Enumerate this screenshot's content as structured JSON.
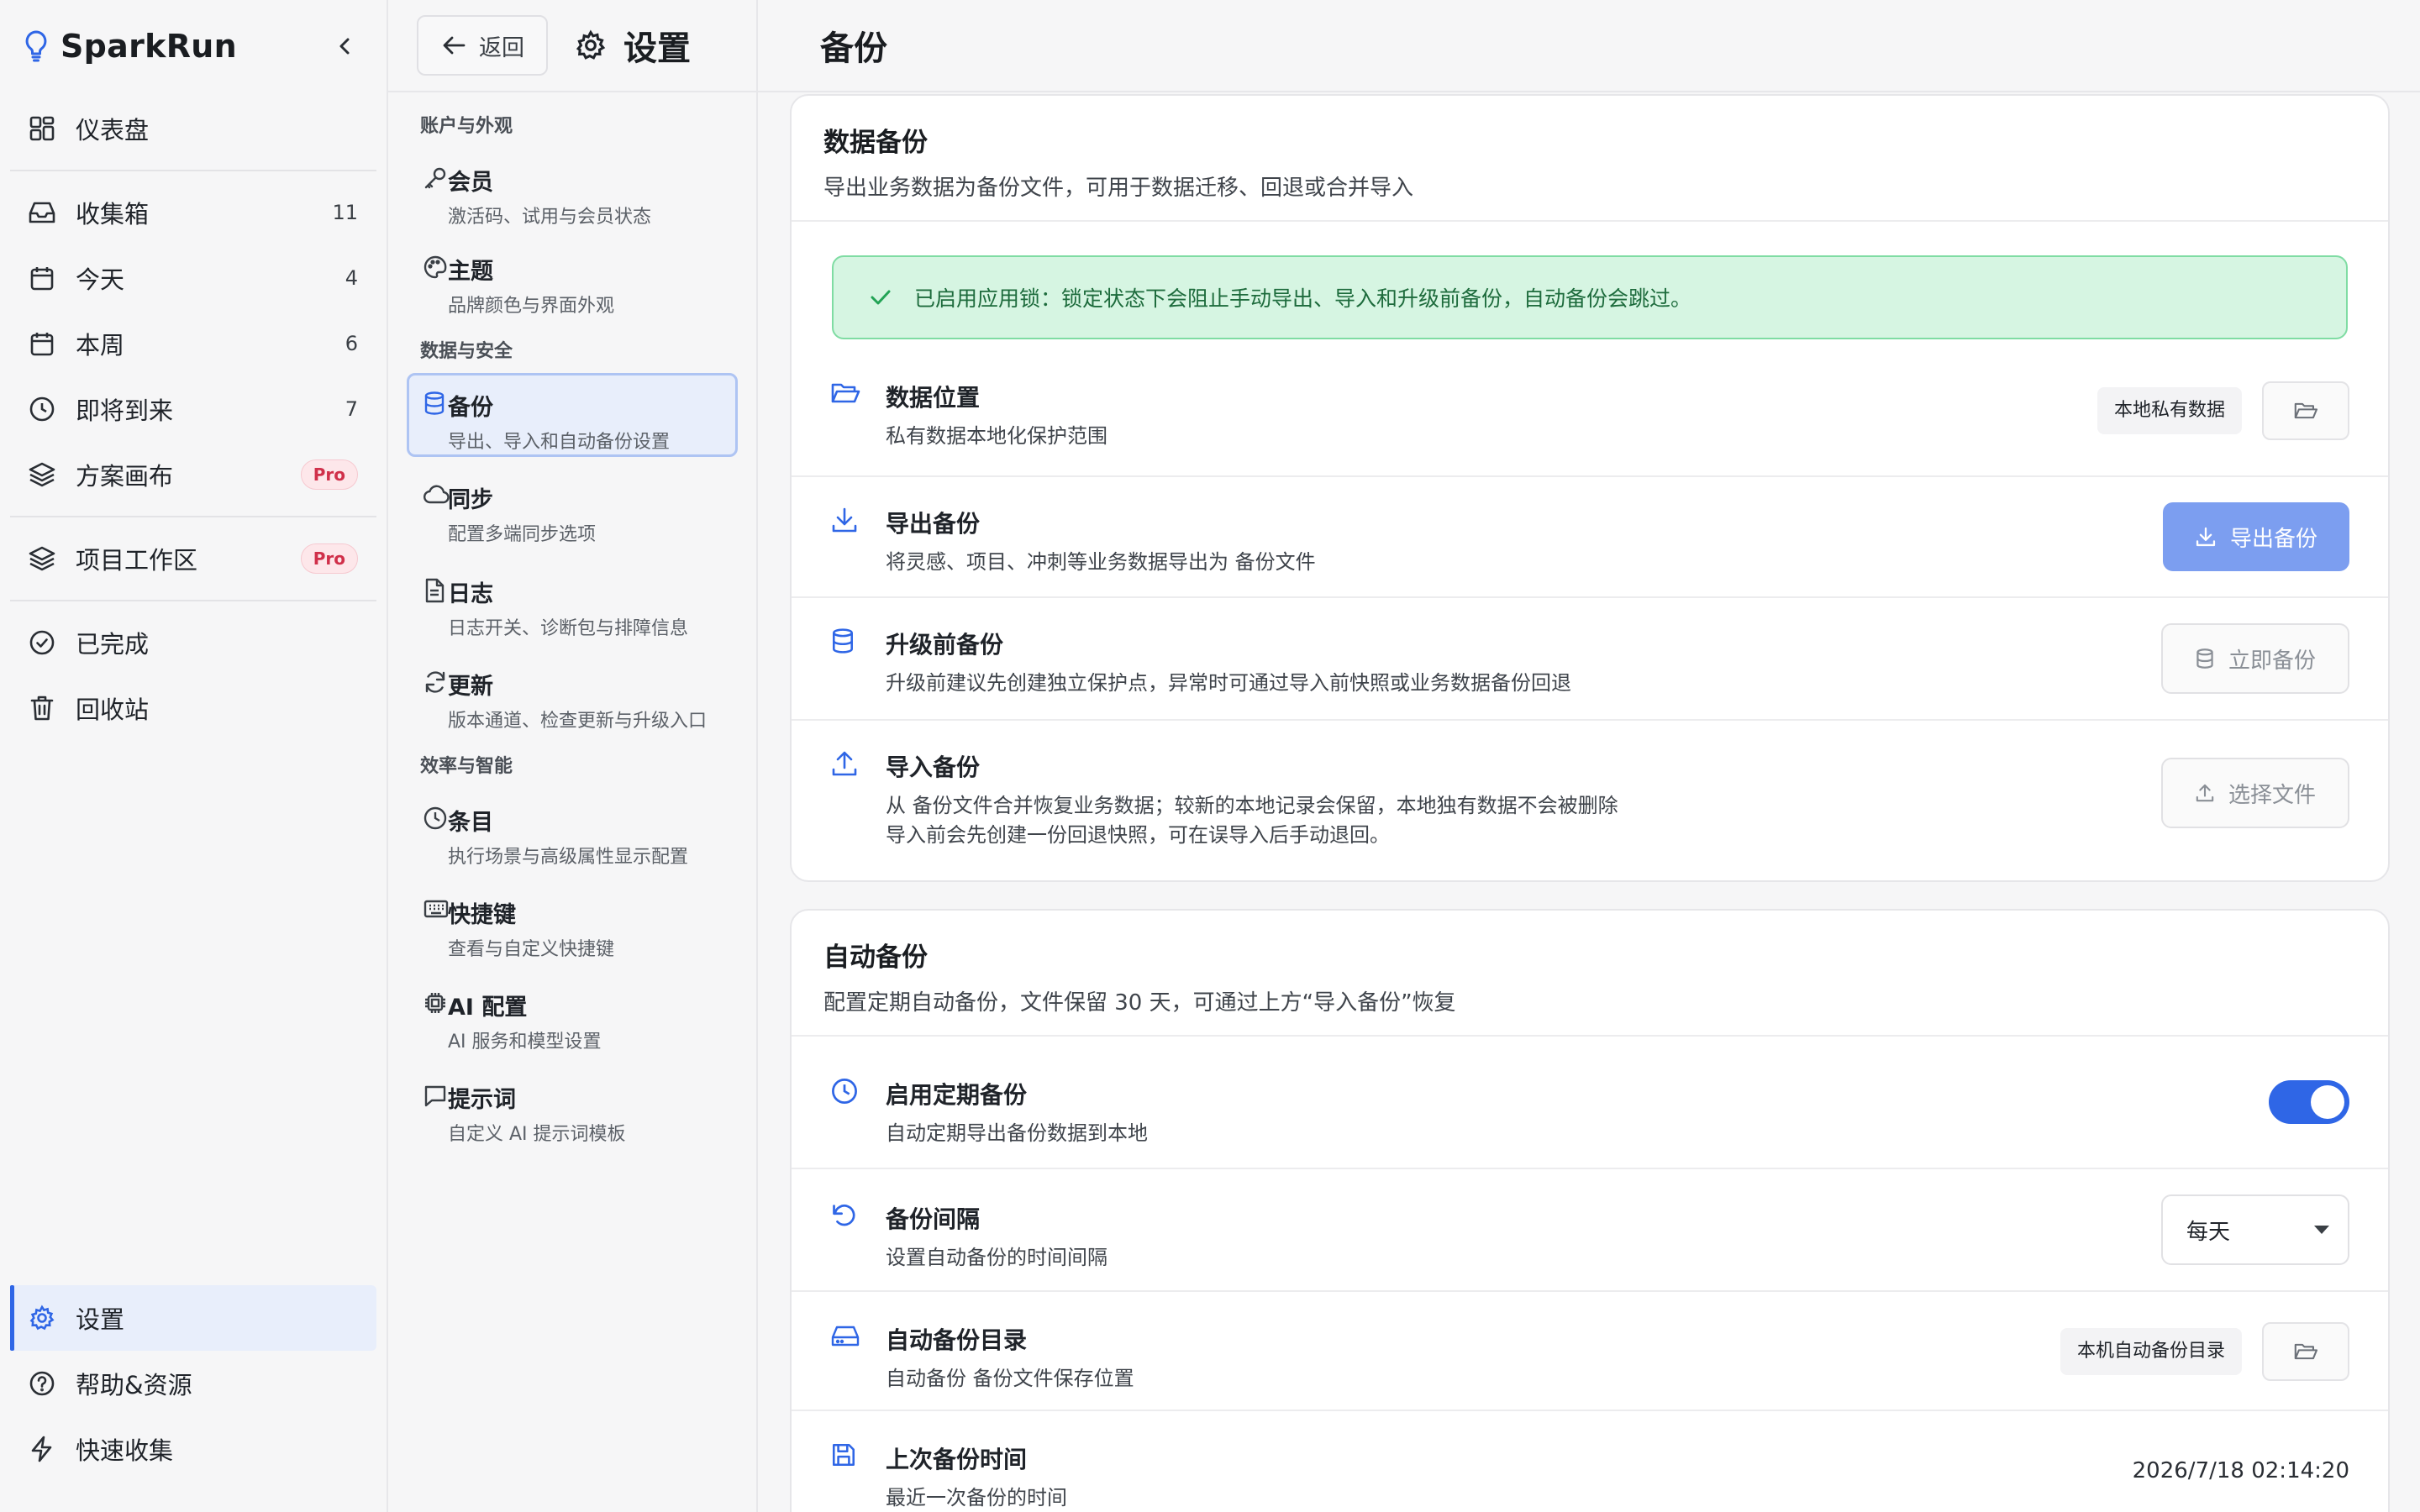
{
  "app": {
    "name": "SparkRun"
  },
  "sidebar": {
    "items": [
      {
        "label": "仪表盘"
      },
      {
        "label": "收集箱",
        "count": "11"
      },
      {
        "label": "今天",
        "count": "4"
      },
      {
        "label": "本周",
        "count": "6"
      },
      {
        "label": "即将到来",
        "count": "7"
      },
      {
        "label": "方案画布",
        "badge": "Pro"
      },
      {
        "label": "项目工作区",
        "badge": "Pro"
      },
      {
        "label": "已完成"
      },
      {
        "label": "回收站"
      }
    ],
    "bottom": [
      {
        "label": "设置"
      },
      {
        "label": "帮助&资源"
      },
      {
        "label": "快速收集"
      }
    ]
  },
  "settings_nav": {
    "back_label": "返回",
    "title": "设置",
    "sections": [
      {
        "title": "账户与外观",
        "items": [
          {
            "title": "会员",
            "desc": "激活码、试用与会员状态"
          },
          {
            "title": "主题",
            "desc": "品牌颜色与界面外观"
          }
        ]
      },
      {
        "title": "数据与安全",
        "items": [
          {
            "title": "备份",
            "desc": "导出、导入和自动备份设置"
          },
          {
            "title": "同步",
            "desc": "配置多端同步选项"
          },
          {
            "title": "日志",
            "desc": "日志开关、诊断包与排障信息"
          },
          {
            "title": "更新",
            "desc": "版本通道、检查更新与升级入口"
          }
        ]
      },
      {
        "title": "效率与智能",
        "items": [
          {
            "title": "条目",
            "desc": "执行场景与高级属性显示配置"
          },
          {
            "title": "快捷键",
            "desc": "查看与自定义快捷键"
          },
          {
            "title": "AI 配置",
            "desc": "AI 服务和模型设置"
          },
          {
            "title": "提示词",
            "desc": "自定义 AI 提示词模板"
          }
        ]
      }
    ]
  },
  "main": {
    "title": "备份",
    "data_backup": {
      "title": "数据备份",
      "desc": "导出业务数据为备份文件，可用于数据迁移、回退或合并导入",
      "alert": "已启用应用锁：锁定状态下会阻止手动导出、导入和升级前备份，自动备份会跳过。",
      "location": {
        "title": "数据位置",
        "desc": "私有数据本地化保护范围",
        "tag": "本地私有数据"
      },
      "export": {
        "title": "导出备份",
        "desc": "将灵感、项目、冲刺等业务数据导出为 备份文件",
        "button": "导出备份"
      },
      "pre_upgrade": {
        "title": "升级前备份",
        "desc": "升级前建议先创建独立保护点，异常时可通过导入前快照或业务数据备份回退",
        "button": "立即备份"
      },
      "import": {
        "title": "导入备份",
        "desc1": "从 备份文件合并恢复业务数据；较新的本地记录会保留，本地独有数据不会被删除",
        "desc2": "导入前会先创建一份回退快照，可在误导入后手动退回。",
        "button": "选择文件"
      }
    },
    "auto_backup": {
      "title": "自动备份",
      "desc": "配置定期自动备份，文件保留 30 天，可通过上方“导入备份”恢复",
      "enable": {
        "title": "启用定期备份",
        "desc": "自动定期导出备份数据到本地",
        "on": true
      },
      "interval": {
        "title": "备份间隔",
        "desc": "设置自动备份的时间间隔",
        "value": "每天"
      },
      "directory": {
        "title": "自动备份目录",
        "desc": "自动备份 备份文件保存位置",
        "tag": "本机自动备份目录"
      },
      "last": {
        "title": "上次备份时间",
        "desc": "最近一次备份的时间",
        "value": "2026/7/18 02:14:20"
      }
    }
  },
  "colors": {
    "accent": "#2f66e6",
    "primary_button": "#7c9ef0",
    "alert_bg": "#d6f5e2",
    "alert_text": "#1d6b3c",
    "pro_badge": "#d0304a"
  }
}
